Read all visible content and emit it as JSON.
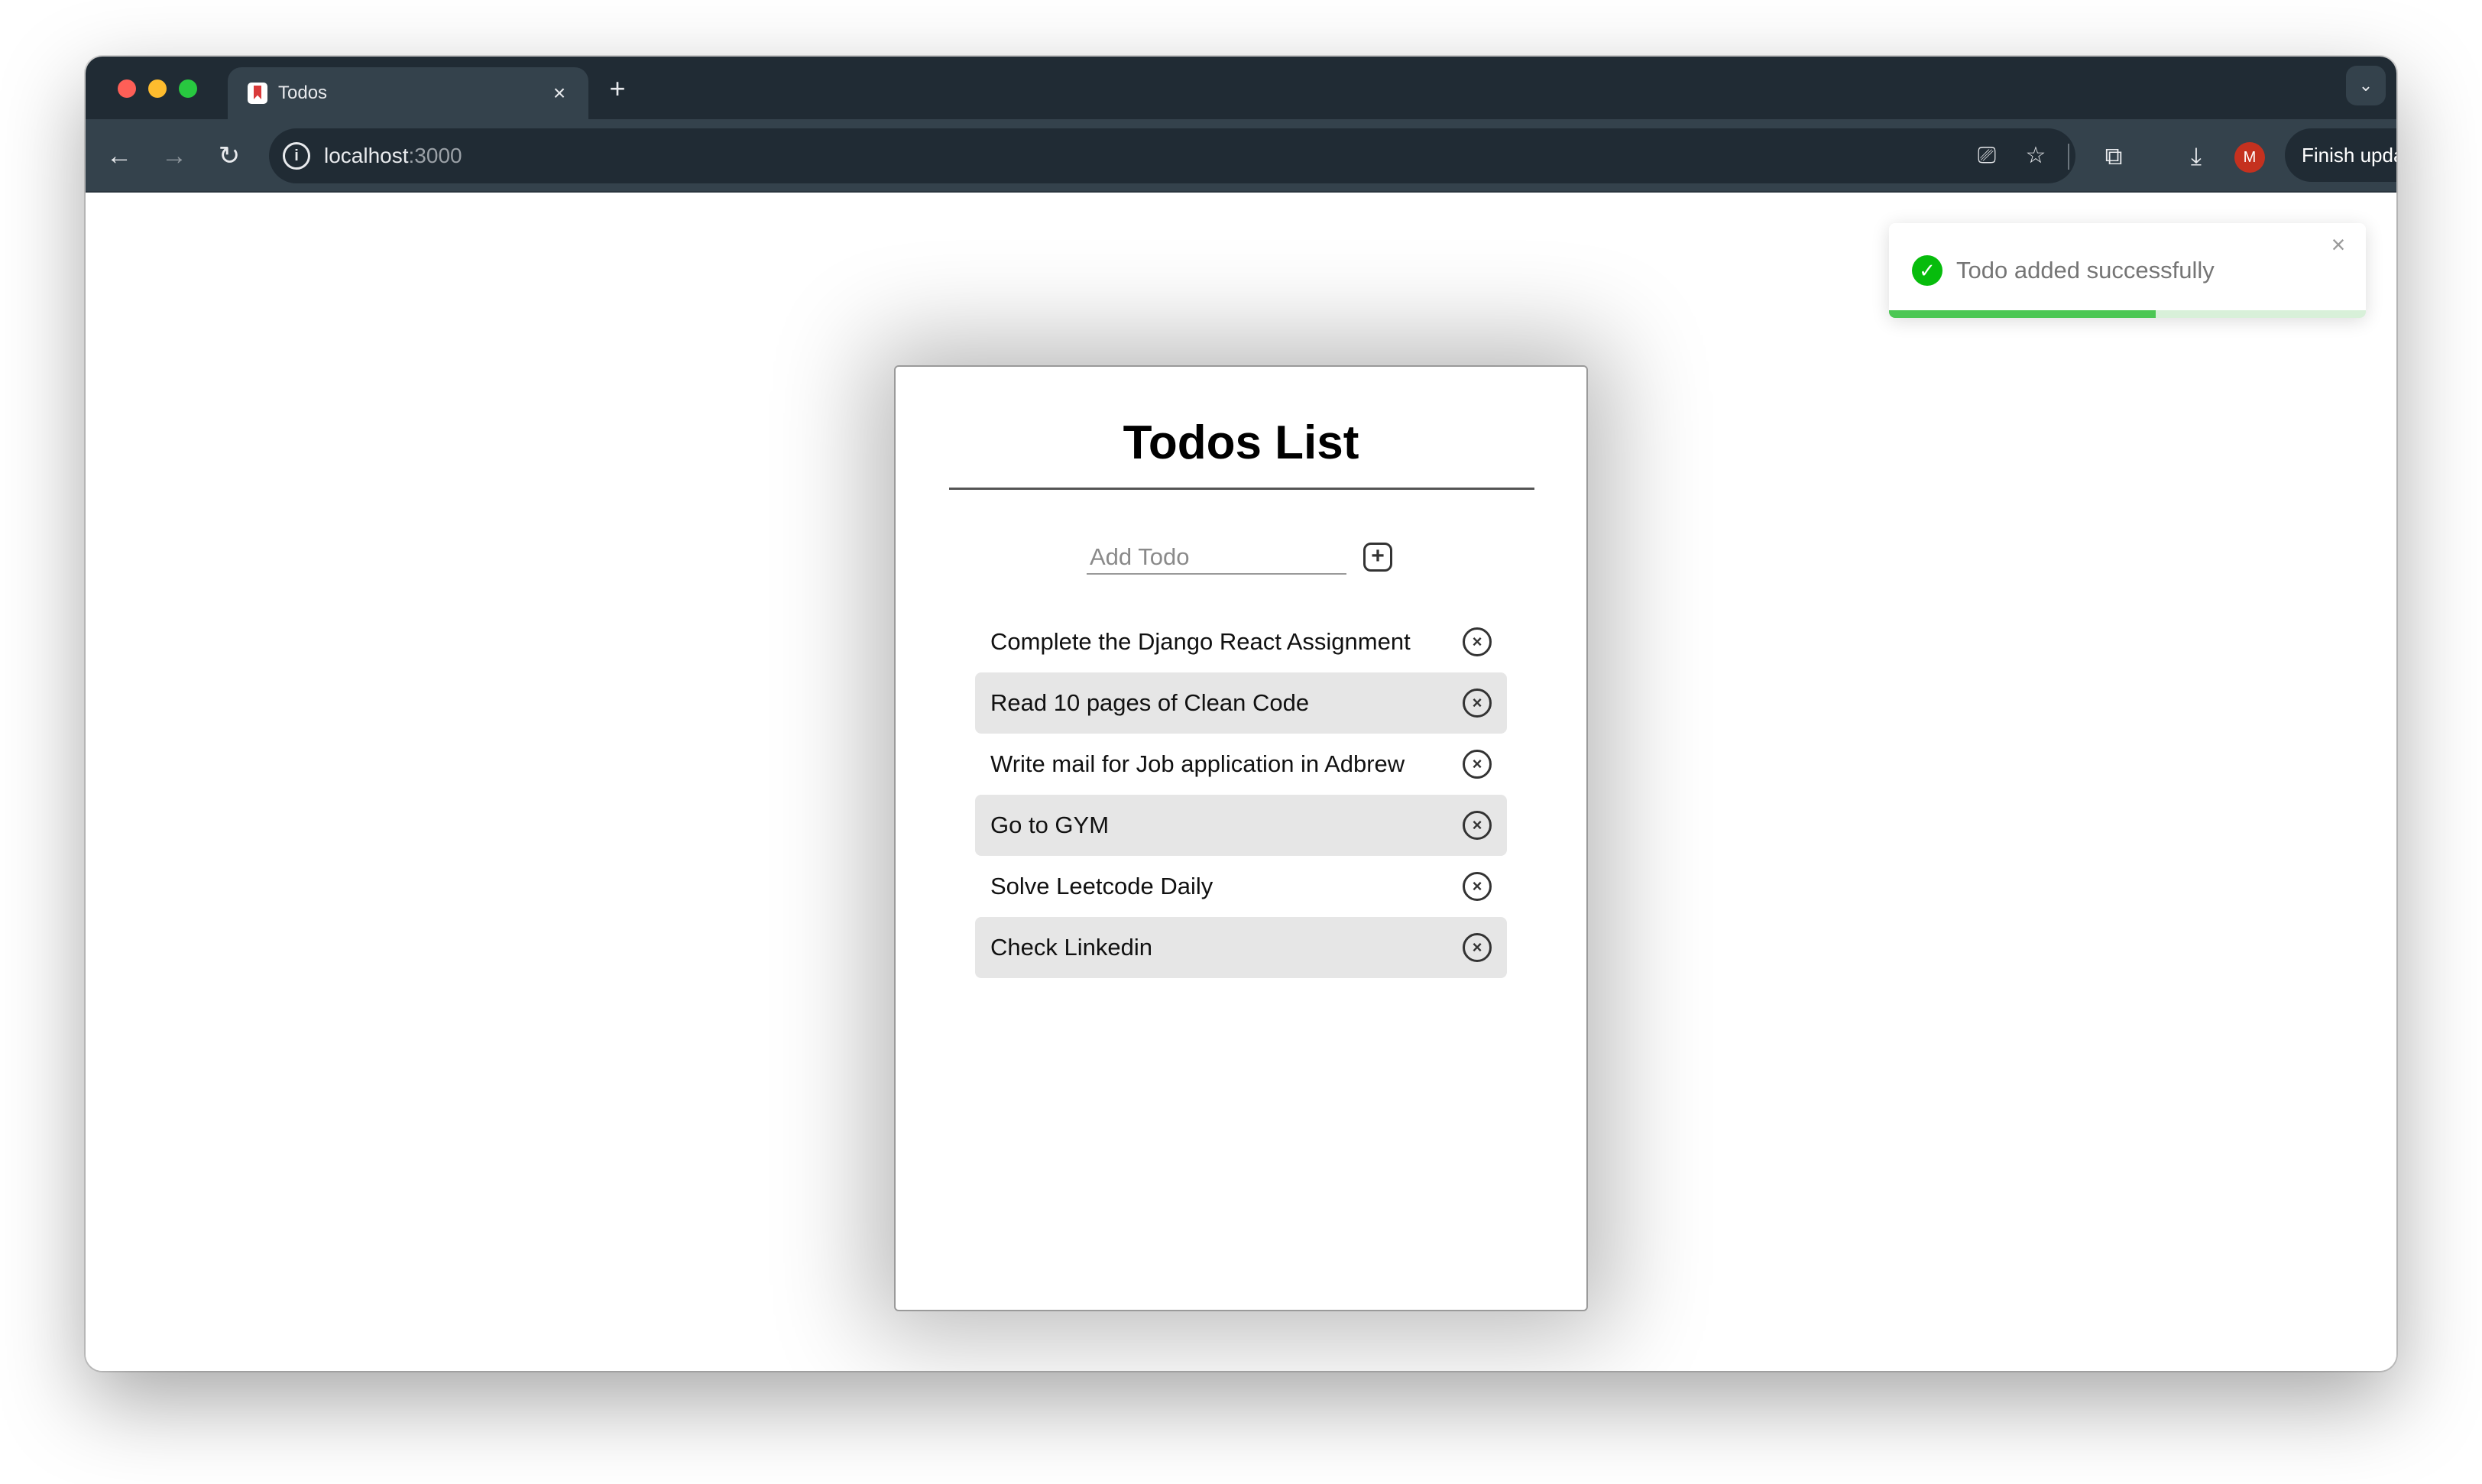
{
  "browser": {
    "tab_title": "Todos",
    "new_tab_symbol": "+",
    "tab_close_symbol": "×",
    "tab_dropdown_symbol": "⌄",
    "url_host": "localhost",
    "url_port": ":3000",
    "finish_update_label": "Finish update",
    "profile_initial": "M"
  },
  "page": {
    "title": "Todos List",
    "add_input": {
      "placeholder": "Add Todo",
      "value": ""
    },
    "add_button_symbol": "+",
    "delete_symbol": "×",
    "todos": [
      {
        "text": "Complete the Django React Assignment"
      },
      {
        "text": "Read 10 pages of Clean Code"
      },
      {
        "text": "Write mail for Job application in Adbrew"
      },
      {
        "text": "Go to GYM"
      },
      {
        "text": "Solve Leetcode Daily"
      },
      {
        "text": "Check Linkedin"
      }
    ]
  },
  "toast": {
    "message": "Todo added successfully",
    "close_symbol": "×",
    "check_symbol": "✓",
    "progress_fraction": 0.56,
    "success_color": "#07bc0c"
  },
  "icons": {
    "back": "arrow-left-icon",
    "forward": "arrow-right-icon",
    "reload": "reload-icon",
    "site_info": "info-icon",
    "cast": "cast-icon",
    "bookmark": "star-icon",
    "extensions": "puzzle-icon",
    "downloads": "download-icon",
    "menu": "kebab-menu-icon"
  }
}
